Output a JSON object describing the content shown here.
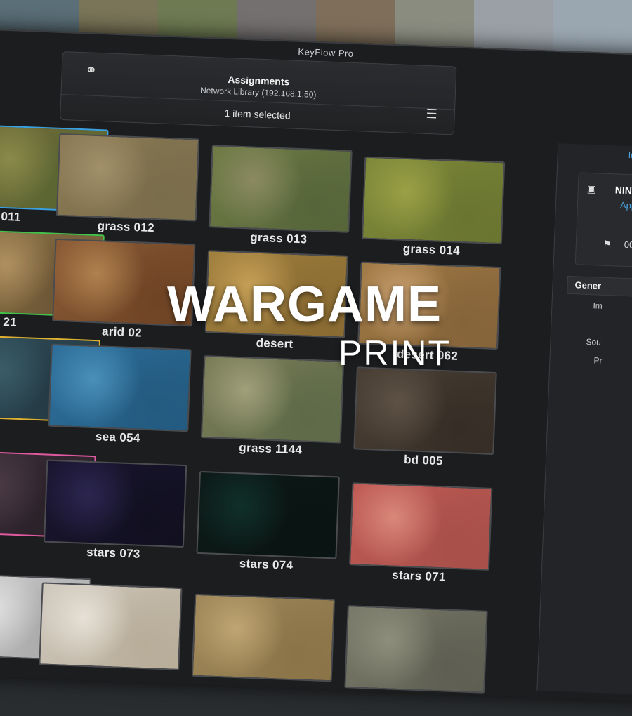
{
  "window": {
    "title": "KeyFlow Pro"
  },
  "toolbar": {
    "title": "Assignments",
    "subtitle": "Network Library (192.168.1.50)",
    "selection": "1 item selected"
  },
  "grid": {
    "items": [
      {
        "label": "011",
        "selected": true,
        "border": "#3aa0e0",
        "colors": [
          "#6f6a3a",
          "#8a8a4a",
          "#596530"
        ]
      },
      {
        "label": "grass 012",
        "colors": [
          "#8b7a55",
          "#a1906a",
          "#7a6d4b"
        ]
      },
      {
        "label": "grass 013",
        "colors": [
          "#6e7a45",
          "#8b8a62",
          "#56663a"
        ]
      },
      {
        "label": "grass 014",
        "colors": [
          "#7f8a3a",
          "#9aa045",
          "#6a7530"
        ]
      },
      {
        "label": "21",
        "border": "#44c24a",
        "colors": [
          "#8a7245",
          "#b09060",
          "#6b5535"
        ]
      },
      {
        "label": "arid 02",
        "colors": [
          "#8a5a35",
          "#b0814e",
          "#6e4425"
        ]
      },
      {
        "label": "desert",
        "colors": [
          "#a0803e",
          "#c49e55",
          "#8a6b32"
        ]
      },
      {
        "label": "desert 062",
        "colors": [
          "#a07a45",
          "#caa070",
          "#86643a"
        ]
      },
      {
        "label": "",
        "border": "#e0b030",
        "colors": [
          "#2e4a55",
          "#3a5c68",
          "#243a44"
        ]
      },
      {
        "label": "sea 054",
        "colors": [
          "#2d6f9a",
          "#4a90b8",
          "#235a80"
        ]
      },
      {
        "label": "grass 1144",
        "colors": [
          "#7b7c58",
          "#a0a07a",
          "#5e6a48"
        ]
      },
      {
        "label": "bd 005",
        "colors": [
          "#4a3f35",
          "#5e5246",
          "#362e26"
        ]
      },
      {
        "label": "",
        "border": "#e05aa0",
        "colors": [
          "#3a2e38",
          "#4a3a44",
          "#2a2028"
        ]
      },
      {
        "label": "stars 073",
        "colors": [
          "#1a1530",
          "#2c2650",
          "#111020"
        ]
      },
      {
        "label": "stars 074",
        "colors": [
          "#0d1a18",
          "#10302a",
          "#0a1412"
        ]
      },
      {
        "label": "stars 071",
        "colors": [
          "#c05a55",
          "#d9887a",
          "#a8504a"
        ]
      },
      {
        "label": "",
        "colors": [
          "#c8c8c8",
          "#e0e0e0",
          "#aaaaaa"
        ]
      },
      {
        "label": "",
        "colors": [
          "#cfc8bd",
          "#e6e0d6",
          "#b8ad99"
        ]
      },
      {
        "label": "",
        "colors": [
          "#a0885a",
          "#bfa573",
          "#8a7448"
        ]
      },
      {
        "label": "",
        "colors": [
          "#7a7a6a",
          "#8e8e7c",
          "#5e5e52"
        ]
      }
    ]
  },
  "side_panel": {
    "tab": "In",
    "name": "NIN",
    "app": "Appl",
    "code": "00",
    "section": "Gener",
    "field1": "Im",
    "field2": "Sou",
    "field3": "Pr"
  },
  "brand": {
    "line1": "WARGAME",
    "line2": "PRINT"
  },
  "icons": {
    "globe": "globe-icon",
    "list": "checklist-icon",
    "film": "film-icon",
    "flag": "flag-icon"
  }
}
